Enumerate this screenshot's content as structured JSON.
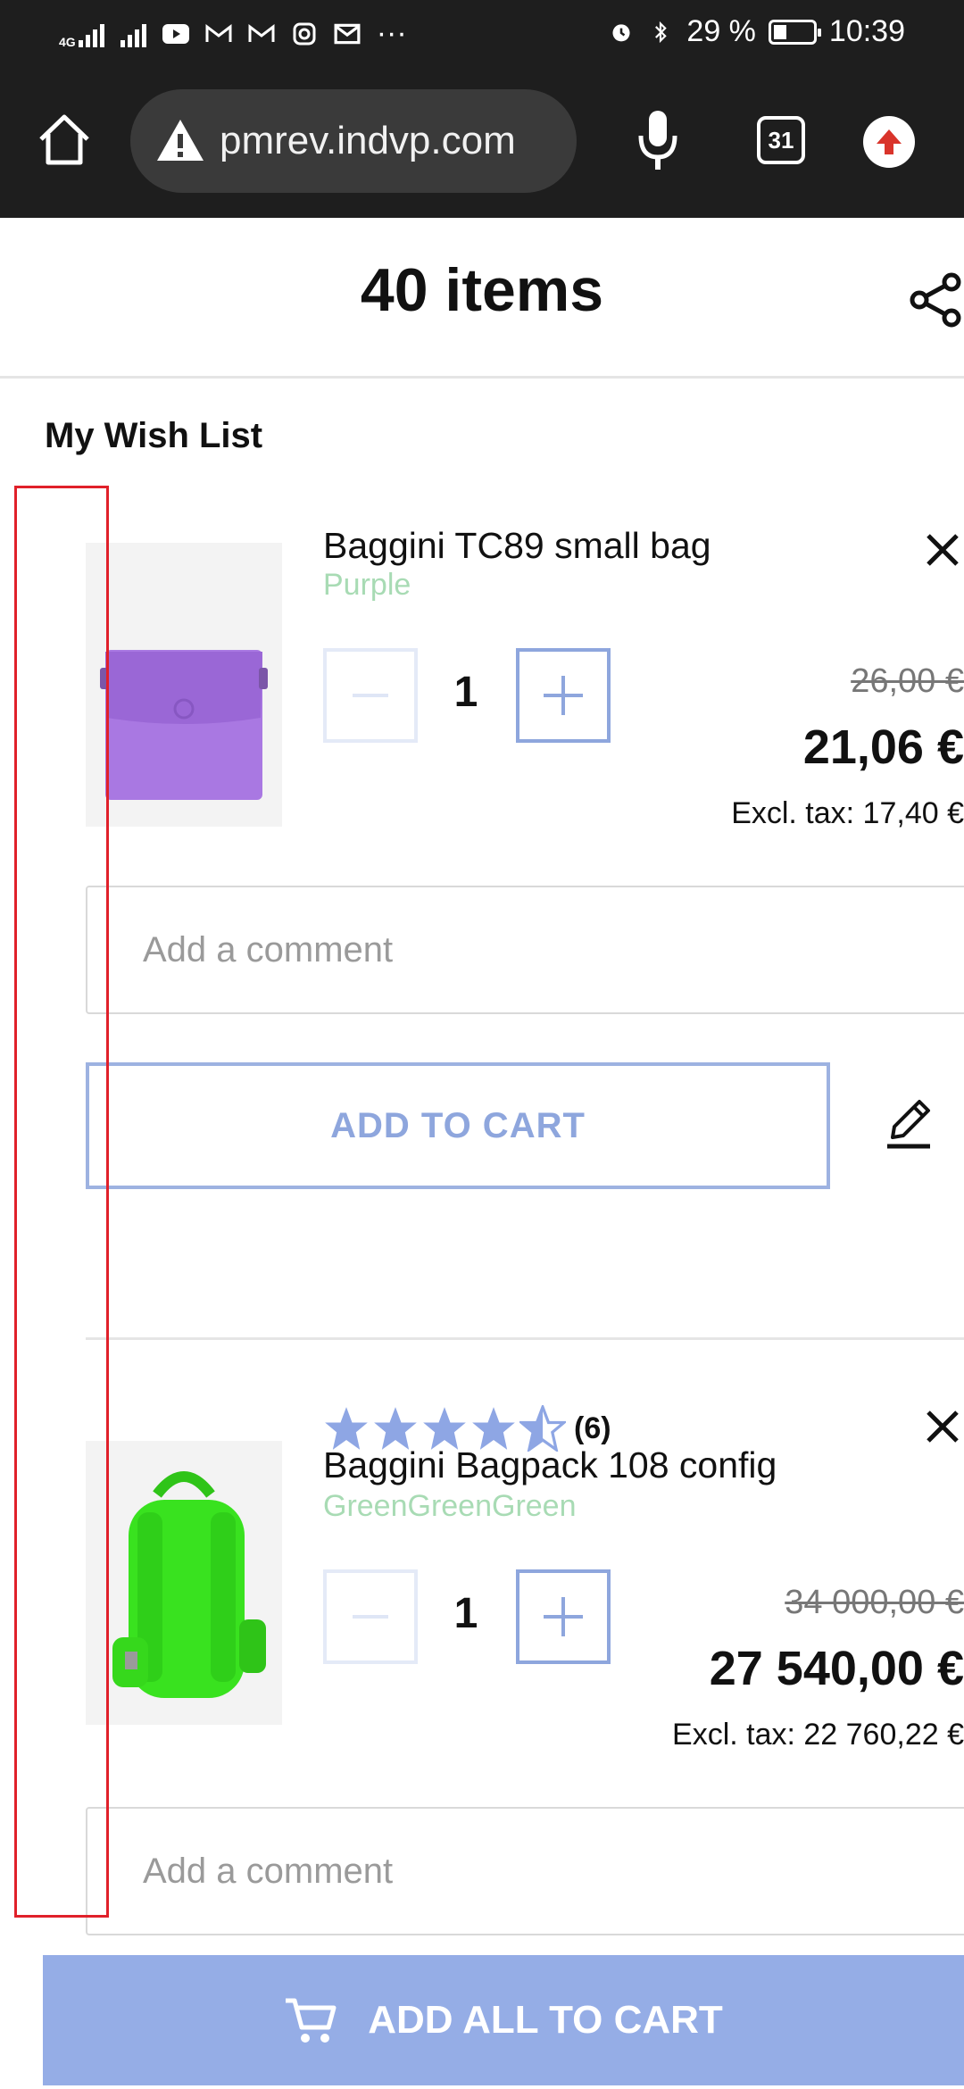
{
  "status_bar": {
    "network_small": "4G",
    "battery_percent": "29 %",
    "battery_level": 0.29,
    "time": "10:39"
  },
  "browser": {
    "url": "pmrev.indvp.com",
    "tab_count": "31"
  },
  "header": {
    "items_count": "40 items"
  },
  "wishlist": {
    "title": "My Wish List",
    "items": [
      {
        "name": "Baggini TC89 small bag",
        "color": "Purple",
        "quantity": "1",
        "old_price": "26,00 €",
        "price": "21,06 €",
        "excl_tax": "Excl. tax: 17,40 €",
        "comment_placeholder": "Add a comment",
        "add_to_cart": "ADD TO CART",
        "image_color": "#a978e2"
      },
      {
        "name": "Baggini Bagpack 108 config",
        "color": "GreenGreenGreen",
        "rating": 4.5,
        "review_count": "(6)",
        "quantity": "1",
        "old_price": "34 000,00 €",
        "price": "27 540,00 €",
        "excl_tax": "Excl. tax: 22 760,22 €",
        "comment_placeholder": "Add a comment",
        "image_color": "#39e21f"
      }
    ]
  },
  "footer": {
    "add_all": "ADD ALL TO CART"
  },
  "colors": {
    "accent": "#8ea6dd",
    "add_all_bg": "#95ade6",
    "variant_text": "#a8dbb4",
    "highlight": "#e0202a"
  }
}
